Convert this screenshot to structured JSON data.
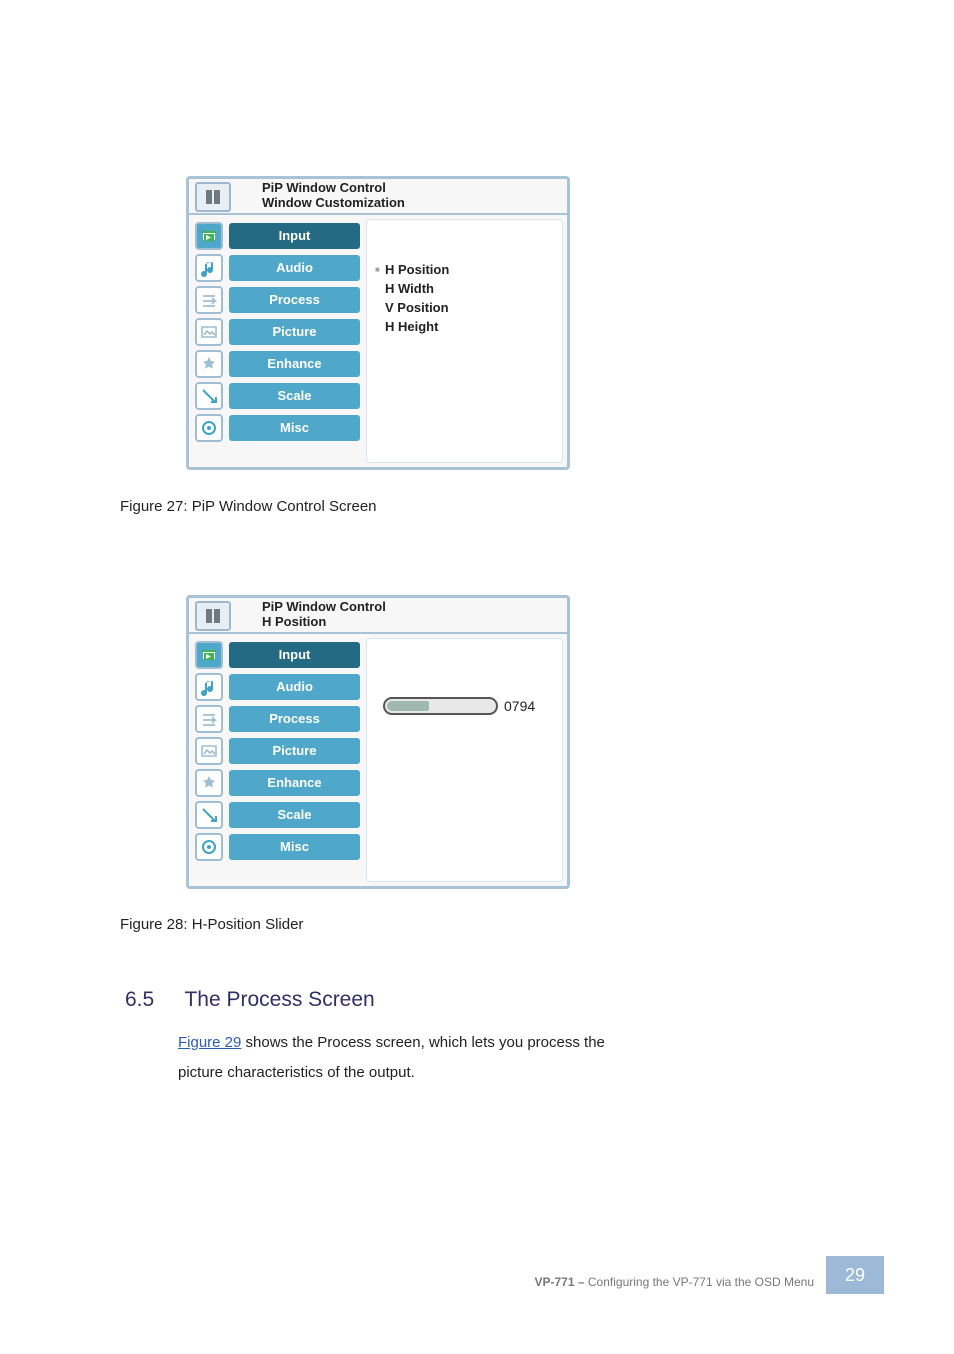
{
  "document": {
    "figure27_caption": "Figure 27: PiP Window Control Screen",
    "figure28_caption": "Figure 28: H-Position Slider",
    "process_heading_num": "6.5",
    "process_heading_text": "The Process Screen",
    "process_body_label": "Figure 29",
    "process_body_text_a": " shows the Process screen, which lets you process the ",
    "process_body_text_b": "picture characteristics of the output.",
    "section_name": "Configuring the VP-771 via the OSD Menu",
    "footer_device": "VP-771 – ",
    "page_number": "29"
  },
  "panel1": {
    "title_line1": "PiP Window Control",
    "title_line2": "Window Customization",
    "sidebar": [
      {
        "label": "Input",
        "active": true,
        "style": "dark",
        "icon": "input"
      },
      {
        "label": "Audio",
        "active": false,
        "style": "light",
        "icon": "audio"
      },
      {
        "label": "Process",
        "active": false,
        "style": "light",
        "icon": "process"
      },
      {
        "label": "Picture",
        "active": false,
        "style": "light",
        "icon": "picture"
      },
      {
        "label": "Enhance",
        "active": false,
        "style": "light",
        "icon": "enhance"
      },
      {
        "label": "Scale",
        "active": false,
        "style": "light",
        "icon": "scale"
      },
      {
        "label": "Misc",
        "active": false,
        "style": "light",
        "icon": "misc"
      }
    ],
    "options": [
      {
        "label": "H Position",
        "selected": true
      },
      {
        "label": "H Width",
        "selected": false
      },
      {
        "label": "V Position",
        "selected": false
      },
      {
        "label": "H Height",
        "selected": false
      }
    ]
  },
  "panel2": {
    "title_line1": "PiP Window Control",
    "title_line2": "H Position",
    "sidebar": [
      {
        "label": "Input",
        "active": true,
        "style": "dark",
        "icon": "input"
      },
      {
        "label": "Audio",
        "active": false,
        "style": "light",
        "icon": "audio"
      },
      {
        "label": "Process",
        "active": false,
        "style": "light",
        "icon": "process"
      },
      {
        "label": "Picture",
        "active": false,
        "style": "light",
        "icon": "picture"
      },
      {
        "label": "Enhance",
        "active": false,
        "style": "light",
        "icon": "enhance"
      },
      {
        "label": "Scale",
        "active": false,
        "style": "light",
        "icon": "scale"
      },
      {
        "label": "Misc",
        "active": false,
        "style": "light",
        "icon": "misc"
      }
    ],
    "slider_value": "0794",
    "slider_pct": 38
  }
}
